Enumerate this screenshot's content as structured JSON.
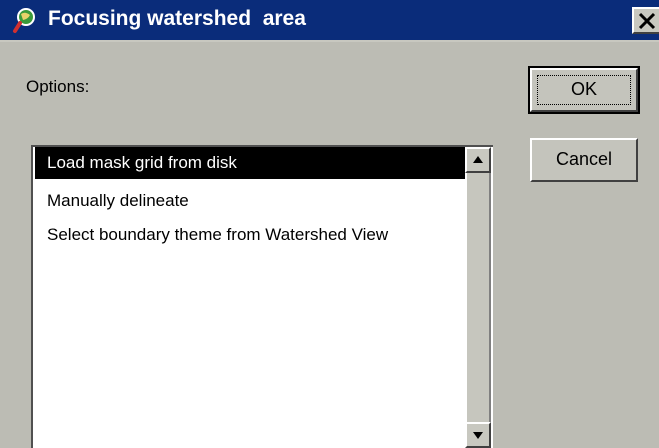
{
  "window": {
    "title": "Focusing watershed  area",
    "title_bar_color": "#0a2c7a",
    "icon": "magnifier-globe-icon"
  },
  "options": {
    "label": "Options:",
    "items": [
      {
        "label": "Load mask grid from disk",
        "selected": true
      },
      {
        "label": "Manually delineate",
        "selected": false
      },
      {
        "label": "Select boundary theme from Watershed View",
        "selected": false
      }
    ]
  },
  "buttons": {
    "ok_label": "OK",
    "cancel_label": "Cancel"
  }
}
